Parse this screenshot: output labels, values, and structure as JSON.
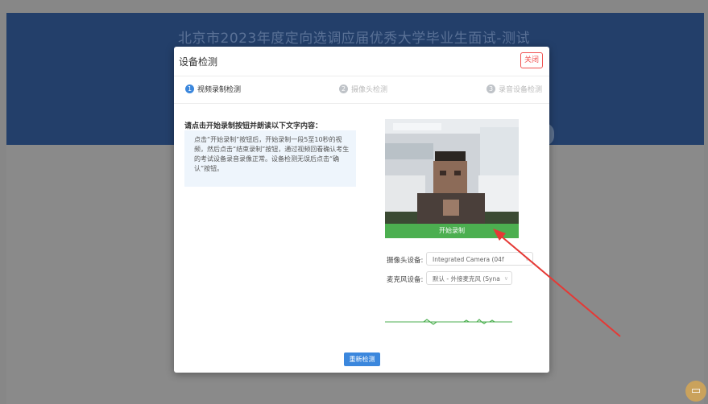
{
  "page": {
    "title": "北京市2023年度定向选调应届优秀大学毕业生面试-测试"
  },
  "modal": {
    "title": "设备检测",
    "close_label": "关闭",
    "steps": [
      {
        "num": "1",
        "label": "视频录制检测",
        "active": true
      },
      {
        "num": "2",
        "label": "摄像头检测",
        "active": false
      },
      {
        "num": "3",
        "label": "录音设备检测",
        "active": false
      }
    ],
    "instructions": {
      "title": "请点击开始录制按钮并朗读以下文字内容：",
      "body": "点击“开始录制”按钮后，开始录制一段5至10秒的视频，然后点击“结束录制”按钮，通过视频回看确认考生的考试设备录音录像正常。设备检测无误后点击“确认”按钮。"
    },
    "record_label": "开始录制",
    "camera": {
      "label": "摄像头设备:",
      "value": "Integrated Camera (04f"
    },
    "microphone": {
      "label": "麦克风设备:",
      "value": "默认 - 外接麦克风 (Syna"
    },
    "recheck_label": "重新检测"
  },
  "colors": {
    "header": "#233f6a",
    "accent_blue": "#3b87dd",
    "record_green": "#4caf50",
    "close_red": "#f0504f",
    "annotation_arrow": "#e53935"
  },
  "icons": {
    "chevron": "chevron-down-icon",
    "help": "chat-help-icon"
  }
}
